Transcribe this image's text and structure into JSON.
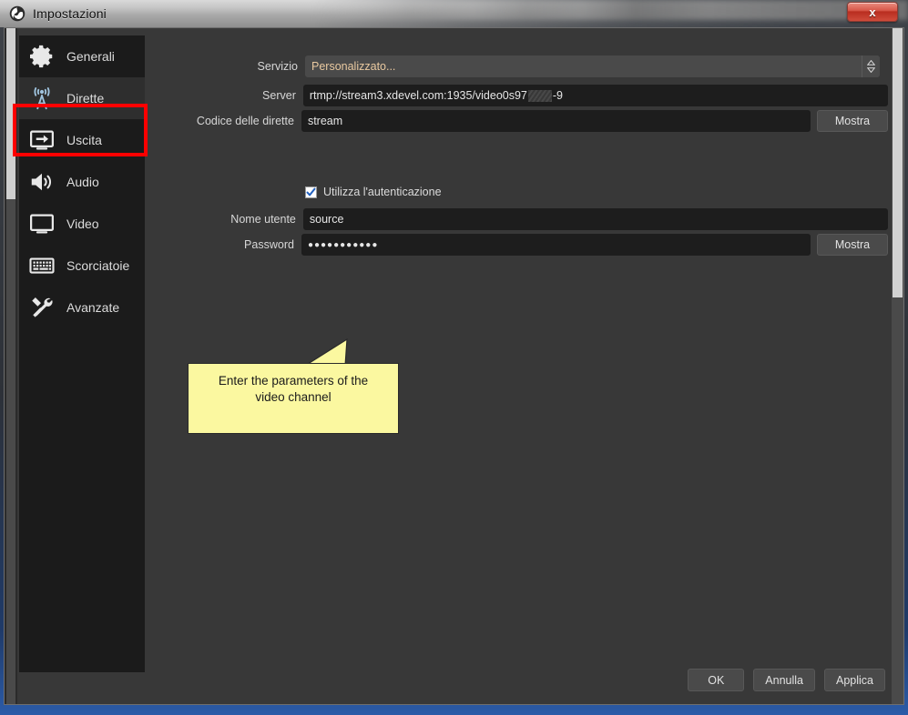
{
  "window": {
    "title": "Impostazioni",
    "close_label": "x",
    "app_icon": "obs-logo-icon"
  },
  "sidebar": {
    "items": [
      {
        "label": "Generali",
        "icon": "gear-icon",
        "selected": false
      },
      {
        "label": "Dirette",
        "icon": "broadcast-icon",
        "selected": true
      },
      {
        "label": "Uscita",
        "icon": "output-icon",
        "selected": false
      },
      {
        "label": "Audio",
        "icon": "speaker-icon",
        "selected": false
      },
      {
        "label": "Video",
        "icon": "monitor-icon",
        "selected": false
      },
      {
        "label": "Scorciatoie",
        "icon": "keyboard-icon",
        "selected": false
      },
      {
        "label": "Avanzate",
        "icon": "tools-icon",
        "selected": false
      }
    ]
  },
  "form": {
    "service": {
      "label": "Servizio",
      "value": "Personalizzato...",
      "options": [
        "Personalizzato..."
      ]
    },
    "server": {
      "label": "Server",
      "value_prefix": "rtmp://stream3.xdevel.com:1935/video0s97",
      "value_suffix": "-9",
      "redacted": true
    },
    "stream_key": {
      "label": "Codice delle dirette",
      "value": "stream",
      "show_button": "Mostra"
    },
    "use_auth": {
      "label": "Utilizza l'autenticazione",
      "checked": true
    },
    "username": {
      "label": "Nome utente",
      "value": "source"
    },
    "password": {
      "label": "Password",
      "value": "●●●●●●●●●●●",
      "show_button": "Mostra"
    }
  },
  "annotation": {
    "callout_text": "Enter the parameters of the video channel",
    "highlight_color": "#ff0000",
    "callout_bg": "#fbf8a0"
  },
  "footer": {
    "ok": "OK",
    "cancel": "Annulla",
    "apply": "Applica"
  },
  "colors": {
    "panel_bg": "#383838",
    "sidebar_bg": "#1b1b1b",
    "input_bg": "#1d1d1d",
    "button_bg": "#4a4a4a",
    "combo_text": "#e9c9a0",
    "accent_blue": "#2b5ba8"
  }
}
